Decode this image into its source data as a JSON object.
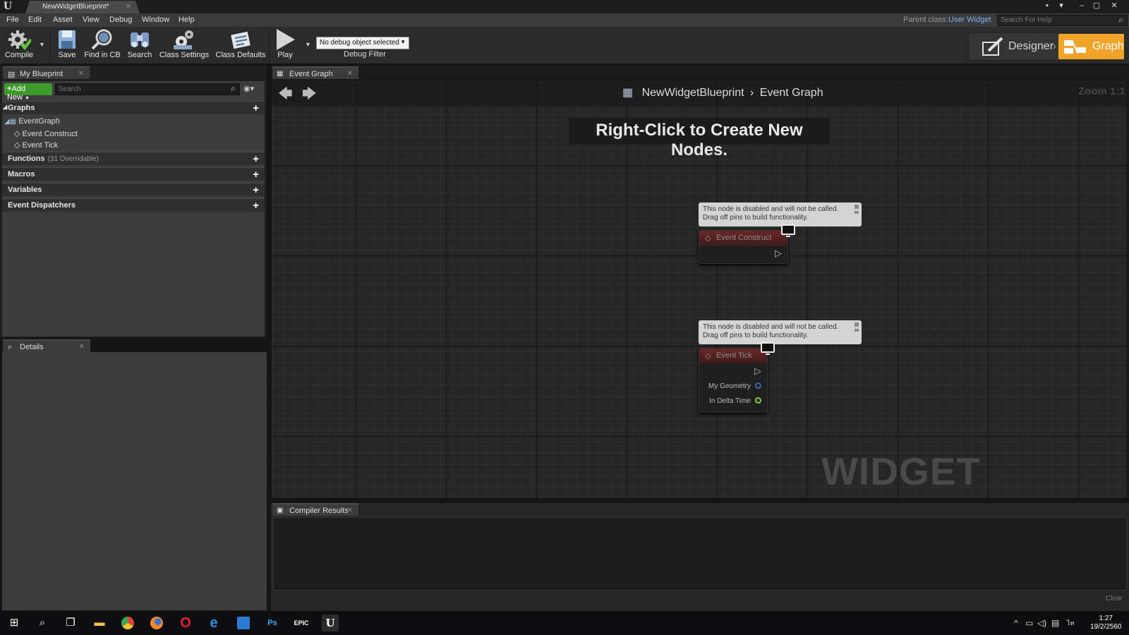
{
  "window": {
    "tab_title": "NewWidgetBlueprint*",
    "controls": [
      "–",
      "▢",
      "✕"
    ]
  },
  "menu": {
    "items": [
      "File",
      "Edit",
      "Asset",
      "View",
      "Debug",
      "Window",
      "Help"
    ],
    "parent_class_label": "Parent class:",
    "parent_class_value": "User Widget",
    "help_search_placeholder": "Search For Help"
  },
  "toolbar": {
    "buttons": [
      {
        "label": "Compile",
        "icon": "compile-gear-icon"
      },
      {
        "label": "Save",
        "icon": "save-disk-icon"
      },
      {
        "label": "Find in CB",
        "icon": "find-in-browser-icon"
      },
      {
        "label": "Search",
        "icon": "binoculars-icon"
      },
      {
        "label": "Class Settings",
        "icon": "class-settings-gears-icon"
      },
      {
        "label": "Class Defaults",
        "icon": "class-defaults-icon"
      },
      {
        "label": "Play",
        "icon": "play-icon"
      }
    ],
    "debug_object": "No debug object selected",
    "debug_filter_label": "Debug Filter",
    "mode_designer": "Designer",
    "mode_graph": "Graph",
    "accent_color": "#f0a52a"
  },
  "my_blueprint": {
    "tab_label": "My Blueprint",
    "add_new": "Add New",
    "search_placeholder": "Search",
    "categories": {
      "graphs": "Graphs",
      "functions": "Functions",
      "functions_sub": "(31 Overridable)",
      "macros": "Macros",
      "variables": "Variables",
      "dispatchers": "Event Dispatchers"
    },
    "tree": {
      "event_graph": "EventGraph",
      "event_construct": "Event Construct",
      "event_tick": "Event Tick"
    }
  },
  "details": {
    "tab_label": "Details"
  },
  "graph": {
    "tab_label": "Event Graph",
    "breadcrumb_root": "NewWidgetBlueprint",
    "breadcrumb_separator": "›",
    "breadcrumb_leaf": "Event Graph",
    "zoom": "Zoom 1:1",
    "hint": "Right-Click to Create New Nodes.",
    "watermark": "WIDGET BLUEPRINT",
    "disabled_comment_line1": "This node is disabled and will not be called.",
    "disabled_comment_line2": "Drag off pins to build functionality.",
    "node_construct_title": "Event Construct",
    "node_tick_title": "Event Tick",
    "pin_geometry": "My Geometry",
    "pin_delta": "In Delta Time"
  },
  "compiler": {
    "tab_label": "Compiler Results",
    "clear": "Clear"
  },
  "taskbar": {
    "time": "1:27",
    "date": "19/2/2560",
    "apps": [
      "start-icon",
      "search-icon",
      "task-view-icon",
      "file-explorer-icon",
      "chrome-icon",
      "firefox-icon",
      "opera-icon",
      "edge-icon",
      "trello-icon",
      "photoshop-icon",
      "epic-launcher-icon",
      "unreal-editor-icon"
    ],
    "ps_label": "Ps",
    "epic_label": "EPIC",
    "ue_label": "U"
  }
}
